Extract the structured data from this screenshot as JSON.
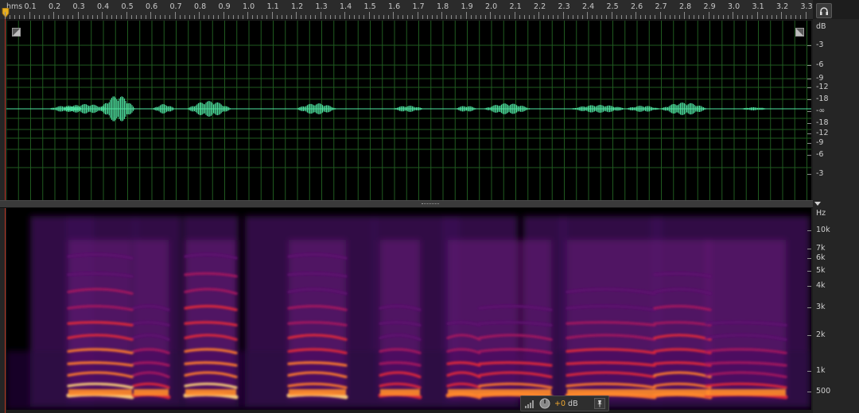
{
  "ruler": {
    "unit_label": "hms",
    "labels": [
      "0.1",
      "0.2",
      "0.3",
      "0.4",
      "0.5",
      "0.6",
      "0.7",
      "0.8",
      "0.9",
      "1.0",
      "1.1",
      "1.2",
      "1.3",
      "1.4",
      "1.5",
      "1.6",
      "1.7",
      "1.8",
      "1.9",
      "2.0",
      "2.1",
      "2.2",
      "2.3",
      "2.4",
      "2.5",
      "2.6",
      "2.7",
      "2.8",
      "2.9",
      "3.0",
      "3.1",
      "3.2",
      "3.3"
    ]
  },
  "waveform": {
    "scale_unit": "dB",
    "scale_labels": [
      "-3",
      "-6",
      "-9",
      "-12",
      "-18",
      "-∞",
      "-18",
      "-12",
      "-9",
      "-6",
      "-3"
    ],
    "wave_color": "#4fe3a0",
    "grid_color": "#1f5a1f"
  },
  "spectrogram": {
    "scale_unit": "Hz",
    "scale_labels": [
      "10k",
      "7k",
      "6k",
      "5k",
      "4k",
      "3k",
      "2k",
      "1k",
      "500"
    ]
  },
  "hud": {
    "gain_value": "+0",
    "gain_unit": "dB"
  },
  "icons": {
    "headphones": "headphones-icon",
    "playhead": "playhead-marker-icon",
    "pin": "pin-icon"
  },
  "colors": {
    "accent": "#f0a830",
    "playhead": "#b5301e"
  }
}
